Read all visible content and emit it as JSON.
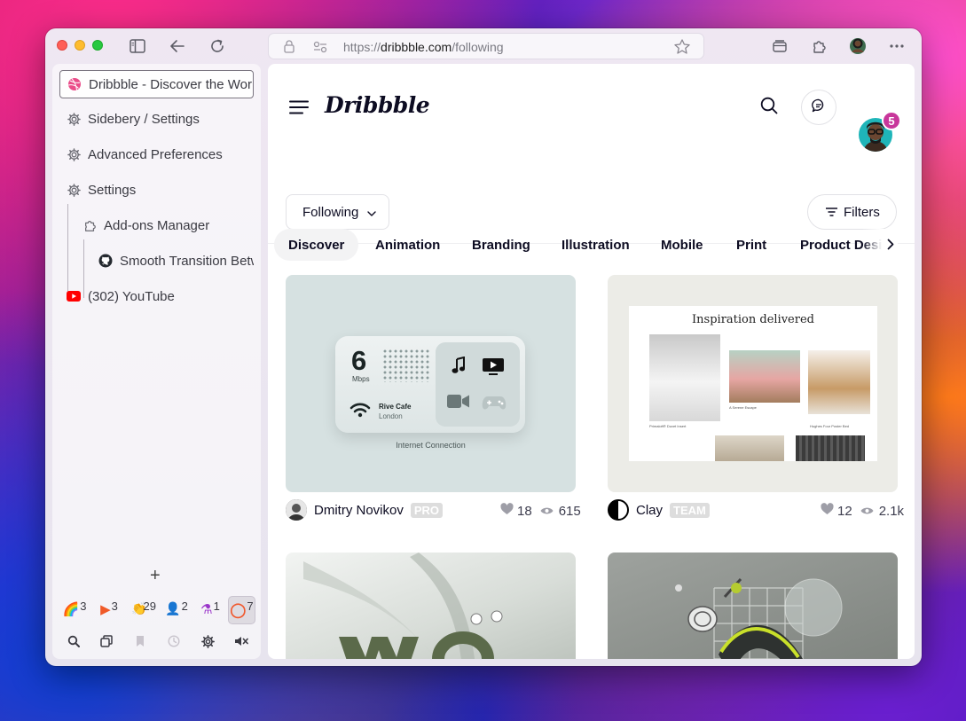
{
  "browser": {
    "url_prefix": "https://",
    "url_domain": "dribbble.com",
    "url_path": "/following"
  },
  "sidebar": {
    "tabs": [
      {
        "label": "Dribbble - Discover the World's Top Designers & Creative Professionals",
        "icon": "dribbble-icon"
      },
      {
        "label": "Sidebery / Settings",
        "icon": "gear-icon"
      },
      {
        "label": "Advanced Preferences",
        "icon": "gear-icon"
      },
      {
        "label": "Settings",
        "icon": "gear-icon"
      },
      {
        "label": "Add-ons Manager",
        "icon": "puzzle-icon"
      },
      {
        "label": "Smooth Transition Between Tabs",
        "icon": "github-icon"
      },
      {
        "label": "(302) YouTube",
        "icon": "youtube-icon"
      }
    ],
    "panels": [
      {
        "emoji": "🌈",
        "count": "3"
      },
      {
        "emoji": "▶",
        "count": "3"
      },
      {
        "emoji": "👏",
        "count": "29"
      },
      {
        "emoji": "👤",
        "count": "2"
      },
      {
        "emoji": "⚗",
        "count": "1"
      },
      {
        "emoji": "◯",
        "count": "7"
      }
    ],
    "add_label": "+"
  },
  "dribbble": {
    "logo": "Dribbble",
    "notification_count": "5",
    "filter_dropdown": "Following",
    "filters_button": "Filters",
    "categories": [
      "Discover",
      "Animation",
      "Branding",
      "Illustration",
      "Mobile",
      "Print",
      "Product Design"
    ],
    "shots": [
      {
        "author": "Dmitry Novikov",
        "badge": "PRO",
        "likes": "18",
        "views": "615",
        "widget": {
          "speed": "6",
          "unit": "Mbps",
          "network": "Rive Cafe",
          "location": "London",
          "caption": "Internet Connection"
        }
      },
      {
        "author": "Clay",
        "badge": "TEAM",
        "likes": "12",
        "views": "2.1k",
        "headline": "Inspiration delivered",
        "captions": [
          "Primaloft® Duvet Insert",
          "A Serene Escape",
          "Hughes Four Poster Bed"
        ]
      }
    ]
  }
}
